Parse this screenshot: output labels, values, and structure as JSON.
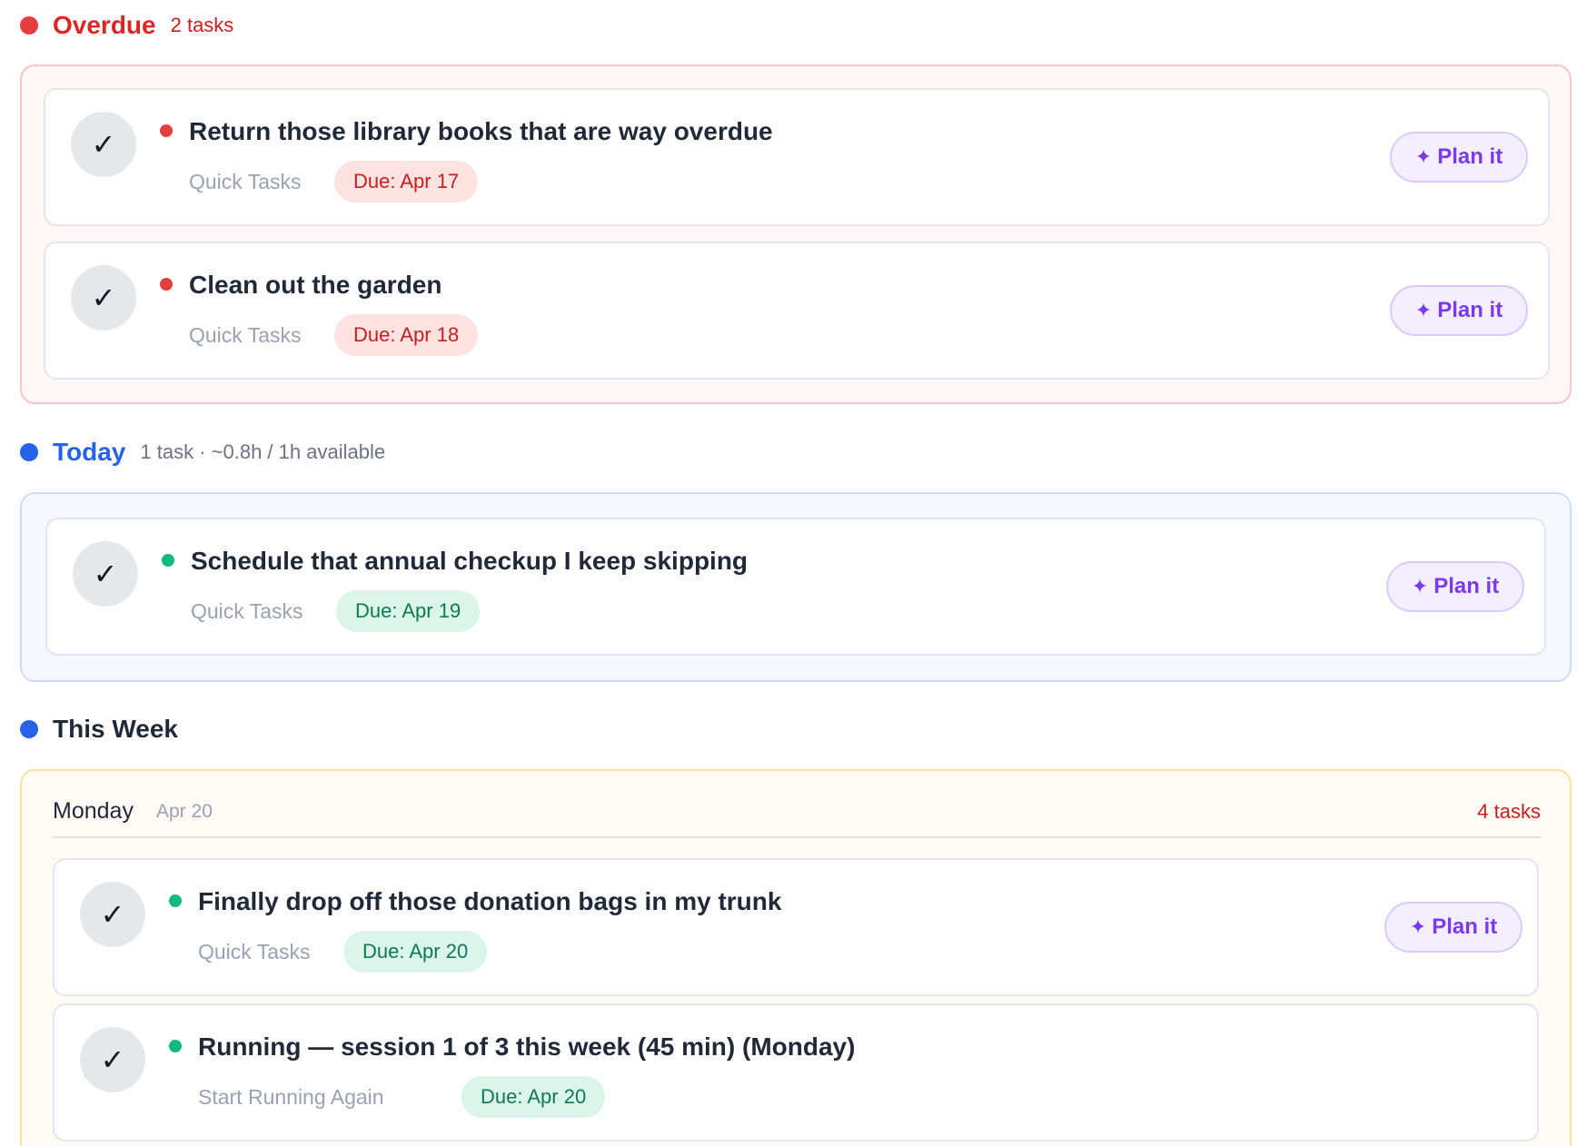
{
  "colors": {
    "overdue": "#e53e3e",
    "today": "#2563eb",
    "this_week": "#2563eb",
    "priority_high": "#e53e3e",
    "priority_low": "#10b981",
    "plan_accent": "#7c3aed"
  },
  "overdue": {
    "title": "Overdue",
    "meta": "2 tasks",
    "tasks": [
      {
        "title": "Return those library books that are way overdue",
        "project": "Quick Tasks",
        "due": "Due: Apr 17",
        "check_icon": "✓",
        "plan_label": "Plan it",
        "plan_icon": "✦"
      },
      {
        "title": "Clean out the garden",
        "project": "Quick Tasks",
        "due": "Due: Apr 18",
        "check_icon": "✓",
        "plan_label": "Plan it",
        "plan_icon": "✦"
      }
    ]
  },
  "today": {
    "title": "Today",
    "meta": "1 task · ~0.8h / 1h available",
    "tasks": [
      {
        "title": "Schedule that annual checkup I keep skipping",
        "project": "Quick Tasks",
        "due": "Due: Apr 19",
        "check_icon": "✓",
        "plan_label": "Plan it",
        "plan_icon": "✦"
      }
    ]
  },
  "this_week": {
    "title": "This Week",
    "days": [
      {
        "name": "Monday",
        "date": "Apr 20",
        "count": "4 tasks",
        "tasks": [
          {
            "title": "Finally drop off those donation bags in my trunk",
            "project": "Quick Tasks",
            "due": "Due: Apr 20",
            "check_icon": "✓",
            "plan_label": "Plan it",
            "plan_icon": "✦"
          },
          {
            "title": "Running — session 1 of 3 this week (45 min) (Monday)",
            "project": "Start Running Again",
            "due": "Due: Apr 20",
            "check_icon": "✓"
          }
        ]
      }
    ]
  }
}
